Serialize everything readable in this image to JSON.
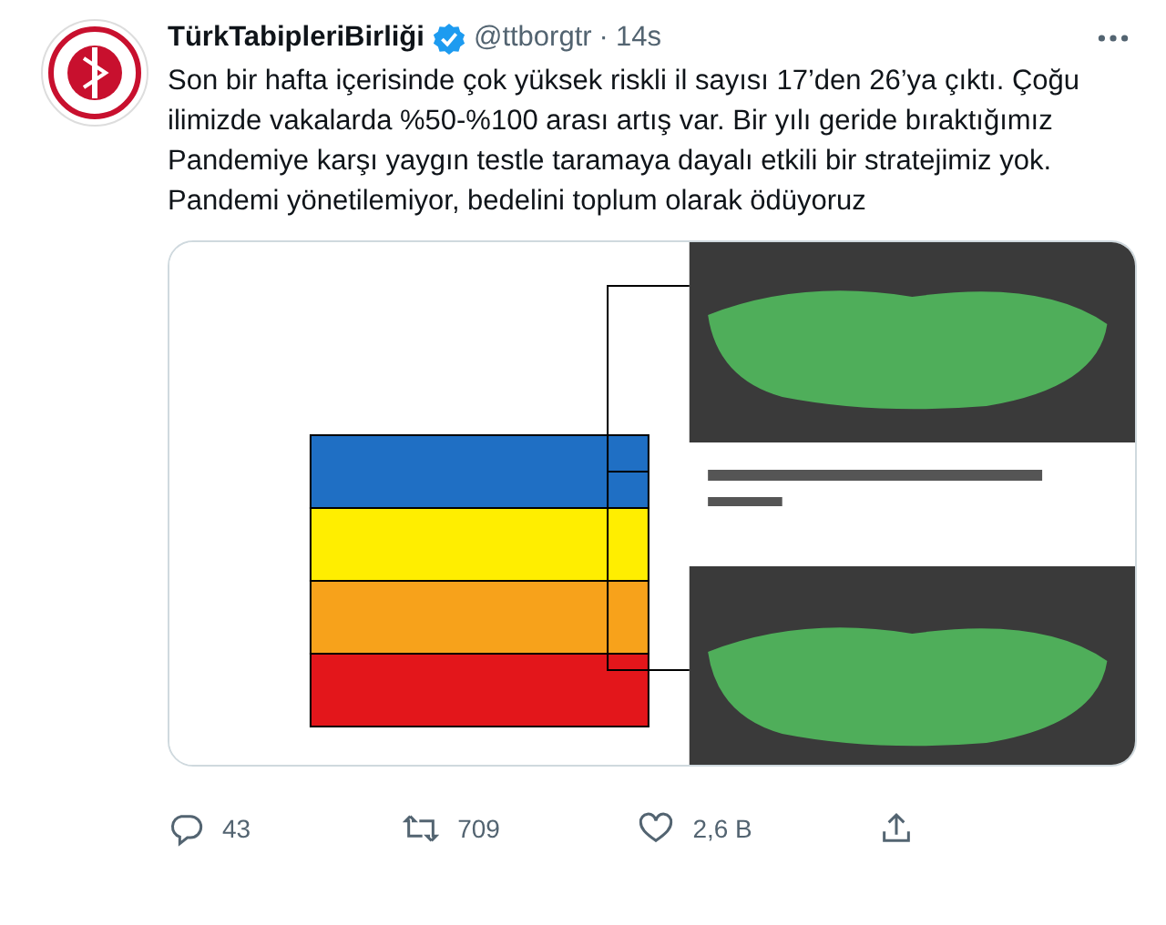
{
  "tweet": {
    "name": "TürkTabipleriBirliği",
    "verified": true,
    "handle": "@ttborgtr",
    "separator": "·",
    "time": "14s",
    "text": "Son bir hafta içerisinde çok yüksek riskli il sayısı 17’den 26’ya çıktı. Çoğu ilimizde vakalarda %50-%100 arası artış var. Bir yılı geride bıraktığımız Pandemiye karşı yaygın testle taramaya dayalı etkili bir stratejimiz yok. Pandemi yönetilemiyor, bedelini toplum olarak ödüyoruz"
  },
  "actions": [
    {
      "kind": "reply",
      "count": "43"
    },
    {
      "kind": "retweet",
      "count": "709"
    },
    {
      "kind": "like",
      "count": "2,6 B"
    },
    {
      "kind": "share"
    }
  ]
}
